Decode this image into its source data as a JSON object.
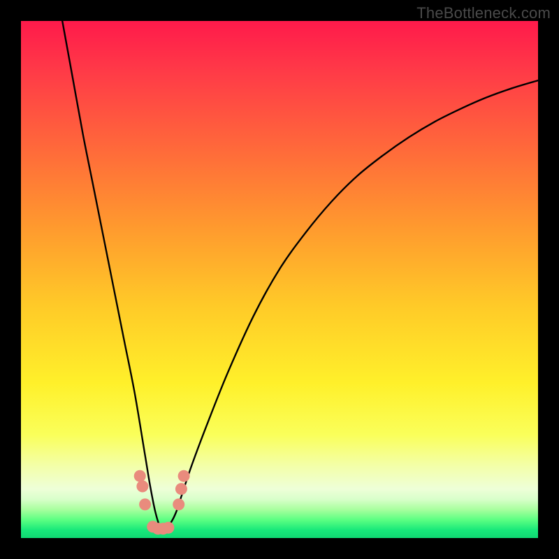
{
  "watermark": "TheBottleneck.com",
  "chart_data": {
    "type": "line",
    "title": "",
    "xlabel": "",
    "ylabel": "",
    "xlim": [
      0,
      100
    ],
    "ylim": [
      0,
      100
    ],
    "grid": false,
    "curve_note": "Black V-shaped bottleneck curve with minimum near x≈27; left branch steep, right branch shallower. Values are estimated from pixel positions; no axis ticks present.",
    "series": [
      {
        "name": "bottleneck-curve",
        "x": [
          8,
          10,
          12,
          14,
          16,
          18,
          20,
          22,
          24,
          25,
          26,
          27,
          28,
          29,
          30,
          31,
          33,
          36,
          40,
          45,
          50,
          55,
          60,
          65,
          70,
          75,
          80,
          85,
          90,
          95,
          100
        ],
        "y": [
          100,
          89,
          78,
          68,
          58,
          48,
          38,
          28,
          16,
          10,
          5,
          2,
          2,
          3,
          5,
          8,
          14,
          22,
          32,
          43,
          52,
          59,
          65,
          70,
          74,
          77.5,
          80.5,
          83,
          85.2,
          87,
          88.5
        ]
      }
    ],
    "markers": {
      "note": "Salmon-colored marker clusters near curve minimum",
      "color": "#e98b7d",
      "points": [
        {
          "x": 23.0,
          "y": 12.0
        },
        {
          "x": 23.5,
          "y": 10.0
        },
        {
          "x": 24.0,
          "y": 6.5
        },
        {
          "x": 25.5,
          "y": 2.2
        },
        {
          "x": 26.5,
          "y": 1.8
        },
        {
          "x": 27.5,
          "y": 1.8
        },
        {
          "x": 28.5,
          "y": 2.0
        },
        {
          "x": 30.5,
          "y": 6.5
        },
        {
          "x": 31.0,
          "y": 9.5
        },
        {
          "x": 31.5,
          "y": 12.0
        }
      ]
    },
    "gradient_bands": [
      {
        "offset": 0.0,
        "color": "#ff1a4b"
      },
      {
        "offset": 0.1,
        "color": "#ff3b47"
      },
      {
        "offset": 0.25,
        "color": "#ff6a3a"
      },
      {
        "offset": 0.4,
        "color": "#ff9a2e"
      },
      {
        "offset": 0.55,
        "color": "#ffca28"
      },
      {
        "offset": 0.7,
        "color": "#fff02a"
      },
      {
        "offset": 0.8,
        "color": "#faff5a"
      },
      {
        "offset": 0.86,
        "color": "#f3ffa8"
      },
      {
        "offset": 0.905,
        "color": "#eeffd8"
      },
      {
        "offset": 0.925,
        "color": "#d8ffca"
      },
      {
        "offset": 0.945,
        "color": "#a8ff9e"
      },
      {
        "offset": 0.965,
        "color": "#5bff82"
      },
      {
        "offset": 0.985,
        "color": "#17e87a"
      },
      {
        "offset": 1.0,
        "color": "#0fd873"
      }
    ]
  }
}
